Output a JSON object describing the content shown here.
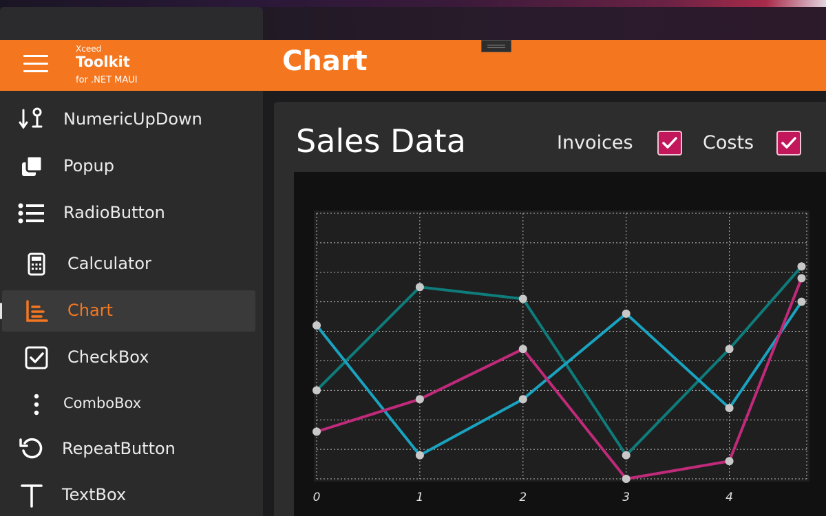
{
  "brand": {
    "top": "Xceed",
    "main": "Toolkit",
    "sub": "for .NET MAUI"
  },
  "page_title": "Chart",
  "sidebar": {
    "items": [
      {
        "label": "NumericUpDown",
        "icon": "numeric-updown-icon"
      },
      {
        "label": "Popup",
        "icon": "popup-icon"
      },
      {
        "label": "RadioButton",
        "icon": "radio-list-icon"
      },
      {
        "label": "Calculator",
        "icon": "calculator-icon"
      },
      {
        "label": "Chart",
        "icon": "chart-icon",
        "active": true
      },
      {
        "label": "CheckBox",
        "icon": "checkbox-icon"
      },
      {
        "label": "ComboBox",
        "icon": "more-vertical-icon"
      },
      {
        "label": "RepeatButton",
        "icon": "repeat-icon"
      },
      {
        "label": "TextBox",
        "icon": "text-icon"
      }
    ]
  },
  "card": {
    "title": "Sales Data",
    "toggles": [
      {
        "label": "Invoices",
        "checked": true
      },
      {
        "label": "Costs",
        "checked": true
      }
    ]
  },
  "colors": {
    "accent": "#f47720",
    "checkbox": "#c2185b",
    "series_teal": "#0e7c7b",
    "series_cyan": "#1aa3c0",
    "series_magenta": "#c02a7a"
  },
  "chart_data": {
    "type": "line",
    "x_tick_labels": [
      "0",
      "1",
      "2",
      "3",
      "4"
    ],
    "grid": true,
    "series": [
      {
        "color": "#0e7c7b",
        "values": [
          [
            0,
            3.0
          ],
          [
            1,
            6.5
          ],
          [
            2,
            6.1
          ],
          [
            3,
            0.8
          ],
          [
            4,
            4.4
          ],
          [
            4.7,
            7.2
          ]
        ]
      },
      {
        "color": "#1aa3c0",
        "values": [
          [
            0,
            5.2
          ],
          [
            1,
            0.8
          ],
          [
            2,
            2.7
          ],
          [
            3,
            5.6
          ],
          [
            4,
            2.4
          ],
          [
            4.7,
            6.0
          ]
        ]
      },
      {
        "color": "#c02a7a",
        "values": [
          [
            0,
            1.6
          ],
          [
            1,
            2.7
          ],
          [
            2,
            4.4
          ],
          [
            3,
            0.0
          ],
          [
            4,
            0.6
          ],
          [
            4.7,
            6.8
          ]
        ]
      }
    ],
    "xlim": [
      0,
      4.75
    ],
    "ylim": [
      0,
      9
    ]
  }
}
